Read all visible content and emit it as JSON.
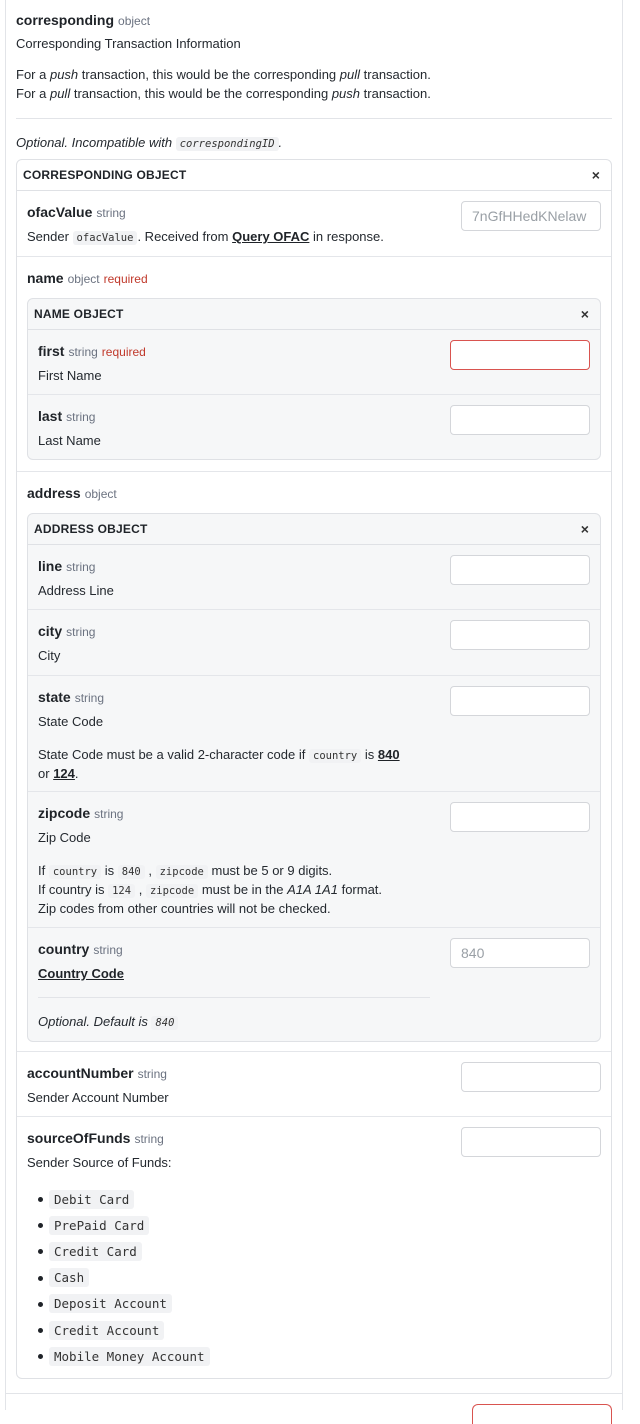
{
  "corresponding": {
    "name": "corresponding",
    "type": "object",
    "title": "Corresponding Transaction Information",
    "push_line": {
      "a": "For a ",
      "b": "push",
      "c": " transaction, this would be the corresponding ",
      "d": "pull",
      "e": " transaction."
    },
    "pull_line": {
      "a": "For a ",
      "b": "pull",
      "c": " transaction, this would be the corresponding ",
      "d": "push",
      "e": " transaction."
    },
    "optional_note": "Optional. Incompatible with",
    "incompatible_code": "correspondingID",
    "incompatible_suffix": "."
  },
  "object_box": {
    "title": "CORRESPONDING OBJECT",
    "close_glyph": "×"
  },
  "ofac": {
    "name": "ofacValue",
    "type": "string",
    "desc_prefix": "Sender",
    "desc_code": "ofacValue",
    "desc_mid": ". Received from",
    "desc_link": "Query OFAC",
    "desc_suffix": "in response.",
    "placeholder": "7nGfHHedKNelaw"
  },
  "name_field": {
    "name": "name",
    "type": "object",
    "required": "required",
    "box_title": "NAME OBJECT",
    "first": {
      "name": "first",
      "type": "string",
      "required": "required",
      "desc": "First Name",
      "value": ""
    },
    "last": {
      "name": "last",
      "type": "string",
      "desc": "Last Name",
      "value": ""
    }
  },
  "address": {
    "name": "address",
    "type": "object",
    "box_title": "ADDRESS OBJECT",
    "line": {
      "name": "line",
      "type": "string",
      "desc": "Address Line"
    },
    "city": {
      "name": "city",
      "type": "string",
      "desc": "City"
    },
    "state": {
      "name": "state",
      "type": "string",
      "desc": "State Code",
      "note_a": "State Code must be a valid 2-character code if",
      "note_code": "country",
      "note_b": "is",
      "note_link1": "840",
      "note_c": "or",
      "note_link2": "124",
      "note_d": "."
    },
    "zipcode": {
      "name": "zipcode",
      "type": "string",
      "desc": "Zip Code",
      "l1_a": "If",
      "l1_code1": "country",
      "l1_b": "is",
      "l1_code2": "840",
      "l1_c": ",",
      "l1_code3": "zipcode",
      "l1_d": "must be 5 or 9 digits.",
      "l2_a": "If country is",
      "l2_code1": "124",
      "l2_b": ",",
      "l2_code2": "zipcode",
      "l2_c": "must be in the",
      "l2_em": "A1A 1A1",
      "l2_d": "format.",
      "l3": "Zip codes from other countries will not be checked."
    },
    "country": {
      "name": "country",
      "type": "string",
      "desc_link": "Country Code",
      "placeholder": "840",
      "optional_note": "Optional. Default is",
      "default_code": "840"
    }
  },
  "account": {
    "name": "accountNumber",
    "type": "string",
    "desc": "Sender Account Number"
  },
  "source": {
    "name": "sourceOfFunds",
    "type": "string",
    "desc": "Sender Source of Funds:",
    "options": [
      "Debit Card",
      "PrePaid Card",
      "Credit Card",
      "Cash",
      "Deposit Account",
      "Credit Account",
      "Mobile Money Account"
    ]
  }
}
